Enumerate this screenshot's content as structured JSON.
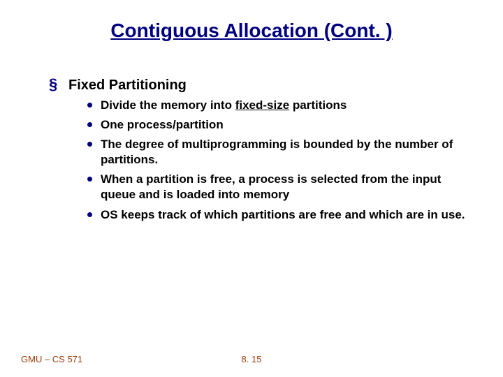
{
  "title": "Contiguous Allocation (Cont. )",
  "heading": "Fixed Partitioning",
  "bullets": {
    "b0_pre": "Divide the memory into ",
    "b0_ul": "fixed-size",
    "b0_post": " partitions",
    "b1": "One process/partition",
    "b2": "The degree of multiprogramming is bounded by the number of partitions.",
    "b3": "When a partition is free, a process is selected from the input queue and is loaded into memory",
    "b4": "OS keeps track of which partitions are free and which are in use."
  },
  "footer": {
    "left": "GMU – CS 571",
    "center": "8. 15"
  }
}
